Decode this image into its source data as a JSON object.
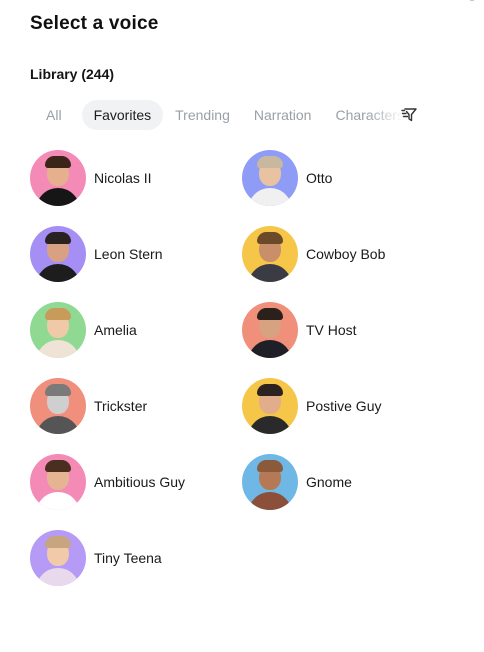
{
  "header": {
    "title": "Select a voice"
  },
  "library": {
    "label": "Library (244)"
  },
  "tabs": [
    {
      "label": "All"
    },
    {
      "label": "Favorites"
    },
    {
      "label": "Trending"
    },
    {
      "label": "Narration"
    },
    {
      "label": "Characters"
    }
  ],
  "active_tab": "Favorites",
  "filter": {
    "icon": "filter-icon"
  },
  "voices": [
    {
      "name": "Nicolas II",
      "bg": "#f48bb7"
    },
    {
      "name": "Otto",
      "bg": "#8f9cf5"
    },
    {
      "name": "Leon Stern",
      "bg": "#a58ff5"
    },
    {
      "name": "Cowboy Bob",
      "bg": "#f6c648"
    },
    {
      "name": "Amelia",
      "bg": "#8fd993"
    },
    {
      "name": "TV Host",
      "bg": "#f1907a"
    },
    {
      "name": "Trickster",
      "bg": "#f08f7c"
    },
    {
      "name": "Postive Guy",
      "bg": "#f6c648"
    },
    {
      "name": "Ambitious Guy",
      "bg": "#f48bb7"
    },
    {
      "name": "Gnome",
      "bg": "#6fb8e6"
    },
    {
      "name": "Tiny Teena",
      "bg": "#b59bf5"
    }
  ]
}
